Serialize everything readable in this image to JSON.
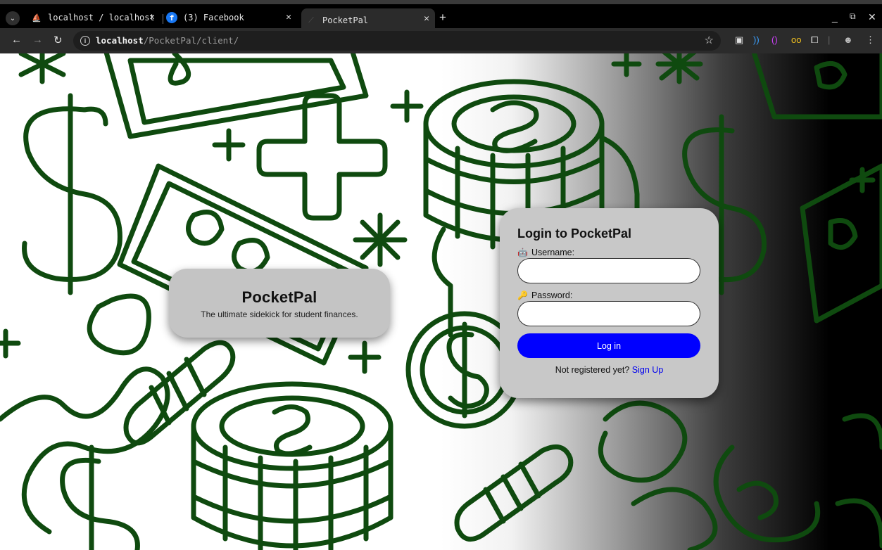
{
  "browser": {
    "tabs": [
      {
        "title": "localhost / localhost",
        "icon": "phpmyadmin-icon"
      },
      {
        "title": "(3) Facebook",
        "icon": "facebook-icon"
      },
      {
        "title": "PocketPal",
        "icon": "loading-icon",
        "active": true
      }
    ],
    "url_host": "localhost",
    "url_path": "/PocketPal/client/"
  },
  "brand": {
    "title": "PocketPal",
    "tagline": "The ultimate sidekick for student finances."
  },
  "login": {
    "title": "Login to PocketPal",
    "username_label": "Username:",
    "username_emoji": "🤖",
    "username_value": "",
    "password_label": "Password:",
    "password_emoji": "🔑",
    "password_value": "",
    "submit_label": "Log in",
    "signup_prompt": "Not registered yet?",
    "signup_link": "Sign Up"
  },
  "colors": {
    "accent": "#0000ff",
    "card": "#c4c4c4",
    "pattern": "#0f4a0f"
  }
}
